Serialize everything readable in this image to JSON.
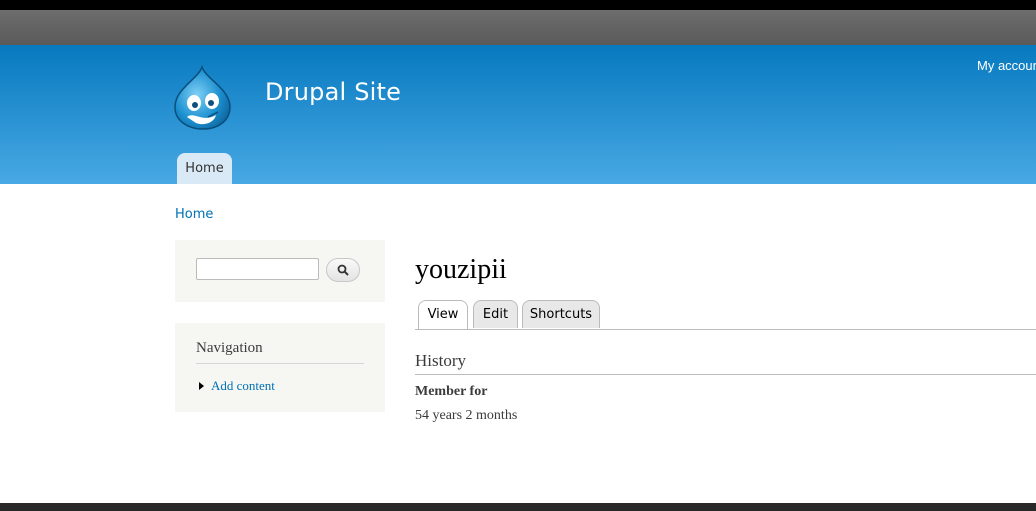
{
  "site": {
    "name": "Drupal Site",
    "logo_icon": "drupal-drop-icon"
  },
  "secondary_menu": {
    "my_account": "My account"
  },
  "main_menu": {
    "home": "Home"
  },
  "breadcrumb": {
    "home": "Home"
  },
  "search": {
    "value": "",
    "button_icon": "search-icon"
  },
  "navigation": {
    "title": "Navigation",
    "items": [
      {
        "label": "Add content"
      }
    ]
  },
  "page": {
    "title": "youzipii",
    "tabs": [
      {
        "label": "View",
        "active": true
      },
      {
        "label": "Edit",
        "active": false
      },
      {
        "label": "Shortcuts",
        "active": false
      }
    ],
    "history": {
      "title": "History",
      "member_label": "Member for",
      "member_value": "54 years 2 months"
    }
  },
  "colors": {
    "header_top": "#0779bf",
    "header_bottom": "#48a9e4",
    "link": "#0071b3",
    "sidebar_bg": "#f6f6f2"
  }
}
